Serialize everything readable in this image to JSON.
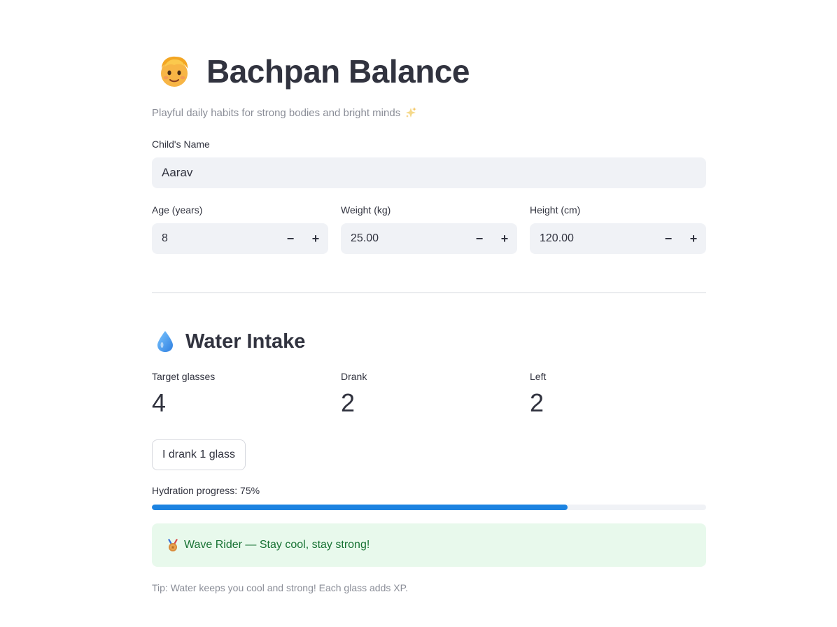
{
  "header": {
    "title": "Bachpan Balance",
    "title_icon": "child-face-icon",
    "subtitle": "Playful daily habits for strong bodies and bright minds",
    "subtitle_icon": "sparkles-icon"
  },
  "profile": {
    "name_label": "Child's Name",
    "name_value": "Aarav",
    "age": {
      "label": "Age (years)",
      "value": "8"
    },
    "weight": {
      "label": "Weight (kg)",
      "value": "25.00"
    },
    "height": {
      "label": "Height (cm)",
      "value": "120.00"
    },
    "minus": "−",
    "plus": "+"
  },
  "water": {
    "section_title": "Water Intake",
    "section_icon": "water-drop-icon",
    "metrics": [
      {
        "label": "Target glasses",
        "value": "4"
      },
      {
        "label": "Drank",
        "value": "2"
      },
      {
        "label": "Left",
        "value": "2"
      }
    ],
    "button_label": "I drank 1 glass",
    "progress_label": "Hydration progress: 75%",
    "progress_value": 0.75,
    "badge_icon": "medal-icon",
    "badge_text": "Wave Rider — Stay cool, stay strong!",
    "tip": "Tip: Water keeps you cool and strong! Each glass adds XP."
  },
  "colors": {
    "accent": "#1c83e1",
    "success_bg": "#e8f9ec",
    "success_text": "#177233",
    "input_bg": "#f0f2f6",
    "text": "#31333f",
    "muted": "#8a8d97"
  }
}
